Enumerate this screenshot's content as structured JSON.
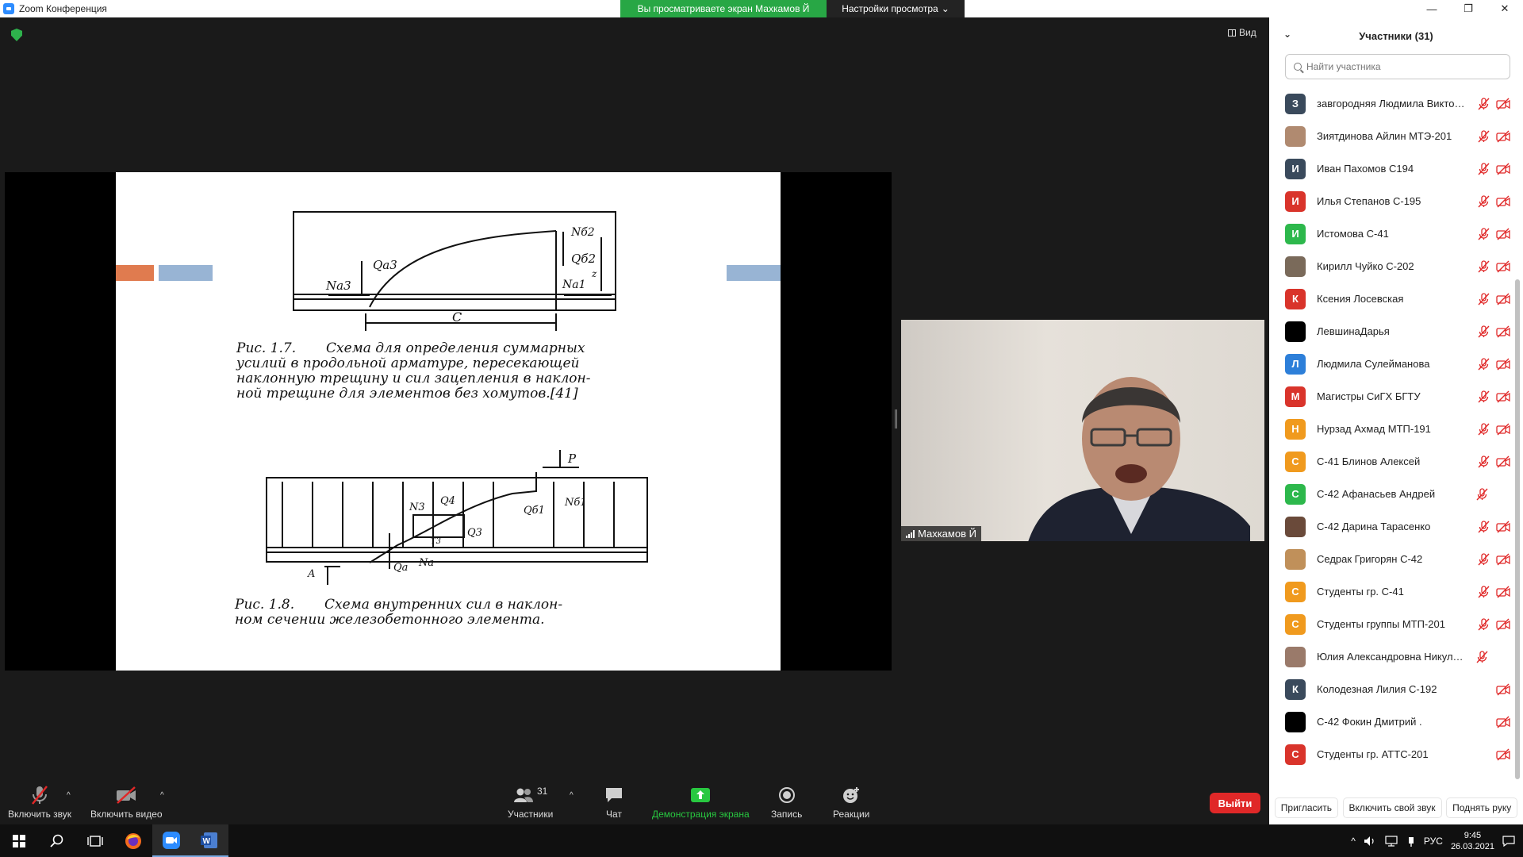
{
  "window": {
    "title": "Zoom Конференция",
    "controls": [
      "—",
      "❐",
      "✕"
    ]
  },
  "share_banner": {
    "viewing_text": "Вы просматриваете экран Махкамов Й",
    "view_settings": "Настройки просмотра",
    "caret": "⌄"
  },
  "top_right": {
    "view_label": "Вид"
  },
  "slide": {
    "fig17_caption": "Рис. 1.7.       Схема для определения суммарных\nусилий в продольной арматуре, пересекающей\nнаклонную трещину и сил зацепления в наклон-\nной трещине для элементов без хомутов.[41]",
    "fig18_caption": "Рис. 1.8.       Схема внутренних сил в наклон-\nном сечении железобетонного элемента.",
    "fig17_labels": {
      "nb2": "Nб2",
      "qb2": "Qб2",
      "qa3": "Qа3",
      "na3": "Nа3",
      "na1": "Nа1",
      "c": "C",
      "z": "z"
    },
    "fig18_labels": {
      "p": "P",
      "n3": "N3",
      "q4": "Q4",
      "qb1": "Qб1",
      "nb1": "Nб1",
      "q3": "Q3",
      "t3": "T3",
      "qa": "Qa",
      "na": "Na",
      "a": "A"
    }
  },
  "video": {
    "name": "Махкамов Й"
  },
  "toolbar": {
    "unmute": "Включить звук",
    "start_video": "Включить видео",
    "participants": "Участники",
    "participants_count": "31",
    "chat": "Чат",
    "share": "Демонстрация экрана",
    "record": "Запись",
    "reactions": "Реакции",
    "leave": "Выйти",
    "caret": "^"
  },
  "panel": {
    "title": "Участники (31)",
    "search_placeholder": "Найти участника",
    "participants": [
      {
        "initial": "З",
        "name": "завгородняя Людмила Викторовна",
        "color": "#3a4a5c",
        "mic": true,
        "cam": true
      },
      {
        "initial": "",
        "name": "Зиятдинова Айлин МТЭ-201",
        "color": "#b08a70",
        "mic": true,
        "cam": true
      },
      {
        "initial": "И",
        "name": "Иван Пахомов С194",
        "color": "#3a4a5c",
        "mic": true,
        "cam": true
      },
      {
        "initial": "И",
        "name": "Илья Степанов С-195",
        "color": "#d9342b",
        "mic": true,
        "cam": true
      },
      {
        "initial": "И",
        "name": "Истомова С-41",
        "color": "#2db84c",
        "mic": true,
        "cam": true
      },
      {
        "initial": "",
        "name": "Кирилл Чуйко С-202",
        "color": "#7a6a5a",
        "mic": true,
        "cam": true
      },
      {
        "initial": "К",
        "name": "Ксения Лосевская",
        "color": "#d9342b",
        "mic": true,
        "cam": true
      },
      {
        "initial": "",
        "name": "ЛевшинаДарья",
        "color": "#000000",
        "mic": true,
        "cam": true
      },
      {
        "initial": "Л",
        "name": "Людмила Сулейманова",
        "color": "#2d7fd9",
        "mic": true,
        "cam": true
      },
      {
        "initial": "М",
        "name": "Магистры СиГХ БГТУ",
        "color": "#d9342b",
        "mic": true,
        "cam": true
      },
      {
        "initial": "Н",
        "name": "Нурзад Ахмад МТП-191",
        "color": "#f09a1e",
        "mic": true,
        "cam": true
      },
      {
        "initial": "С",
        "name": "С-41 Блинов Алексей",
        "color": "#f09a1e",
        "mic": true,
        "cam": true
      },
      {
        "initial": "С",
        "name": "С-42 Афанасьев Андрей",
        "color": "#2db84c",
        "mic": true,
        "cam": false
      },
      {
        "initial": "",
        "name": "С-42 Дарина Тарасенко",
        "color": "#6a4a3a",
        "mic": true,
        "cam": true
      },
      {
        "initial": "",
        "name": "Седрак Григорян С-42",
        "color": "#c0905a",
        "mic": true,
        "cam": true
      },
      {
        "initial": "С",
        "name": "Студенты гр. С-41",
        "color": "#f09a1e",
        "mic": true,
        "cam": true
      },
      {
        "initial": "С",
        "name": "Студенты группы МТП-201",
        "color": "#f09a1e",
        "mic": true,
        "cam": true
      },
      {
        "initial": "",
        "name": "Юлия Александровна Никулина",
        "color": "#9a7a6a",
        "mic": true,
        "cam": false
      },
      {
        "initial": "К",
        "name": "Колодезная Лилия С-192",
        "color": "#3a4a5c",
        "mic": false,
        "cam": true
      },
      {
        "initial": "",
        "name": "С-42 Фокин Дмитрий .",
        "color": "#000000",
        "mic": false,
        "cam": true
      },
      {
        "initial": "С",
        "name": "Студенты гр. АТТС-201",
        "color": "#d9342b",
        "mic": false,
        "cam": true
      }
    ],
    "footer": {
      "invite": "Пригласить",
      "unmute_me": "Включить свой звук",
      "raise_hand": "Поднять руку"
    }
  },
  "taskbar": {
    "lang": "РУС",
    "time": "9:45",
    "date": "26.03.2021",
    "tray_caret": "^"
  },
  "colors": {
    "accent_green": "#28a745",
    "leave_red": "#e02828",
    "zoom_blue": "#2d8cff"
  }
}
